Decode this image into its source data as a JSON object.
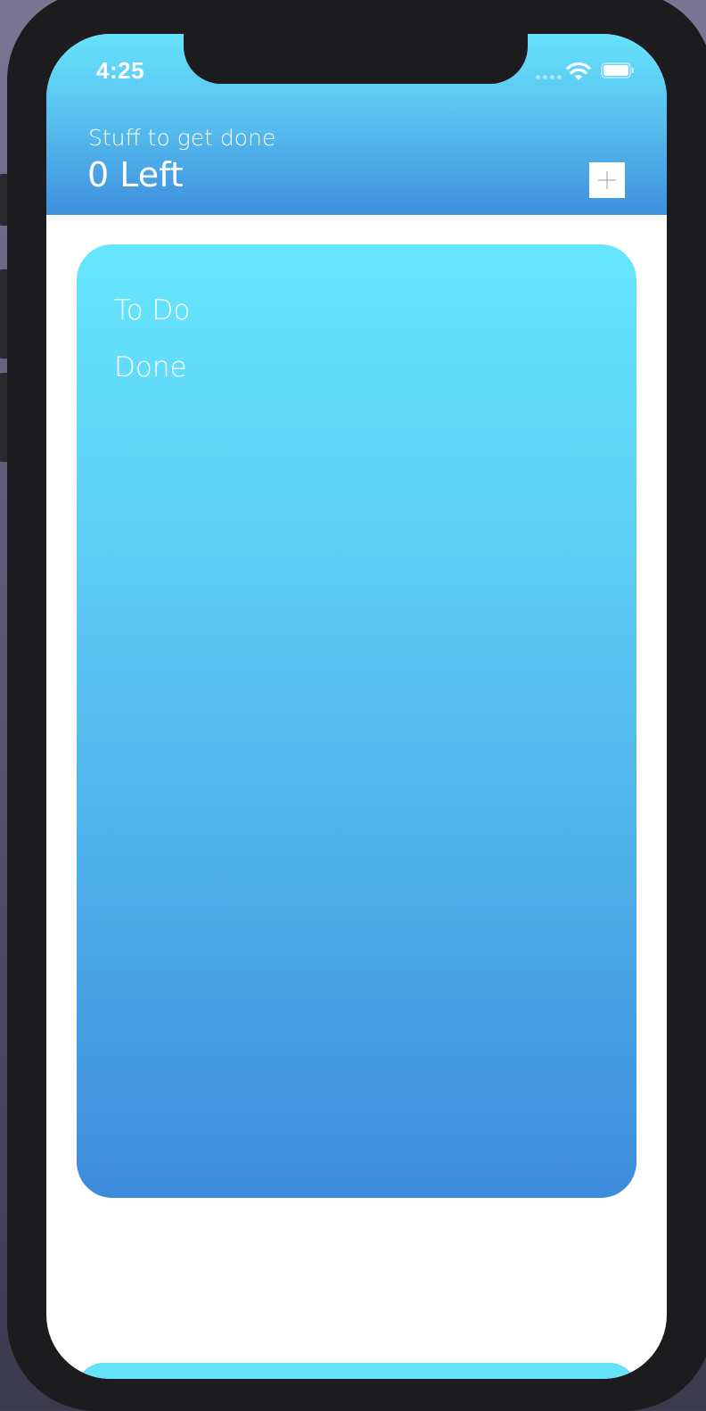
{
  "status_bar": {
    "time": "4:25",
    "icons": [
      "cellular-dots-icon",
      "wifi-icon",
      "battery-icon"
    ]
  },
  "header": {
    "subtitle": "Stuff to get done",
    "count_label": "0 Left",
    "add_button_icon": "plus-icon"
  },
  "card": {
    "items": [
      {
        "label": "To Do"
      },
      {
        "label": "Done"
      }
    ]
  },
  "colors": {
    "gradient_top": "#66e2fb",
    "gradient_bottom": "#3d8cdc",
    "text": "#ffffff",
    "frame": "#1c1c1e"
  }
}
